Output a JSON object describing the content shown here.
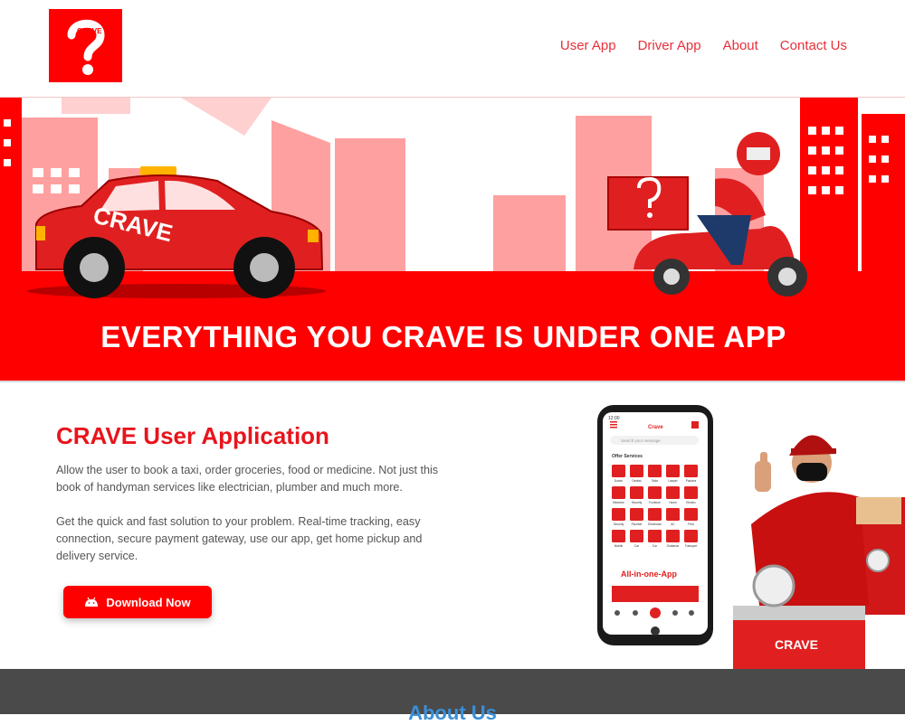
{
  "header": {
    "logo_text": "CRAVE",
    "nav": [
      "User App",
      "Driver App",
      "About",
      "Contact Us"
    ]
  },
  "hero": {
    "headline": "EVERYTHING YOU CRAVE IS UNDER ONE APP",
    "car_text": "CRAVE"
  },
  "user_app": {
    "title": "CRAVE User Application",
    "paragraph1": "Allow the user to book a taxi, order groceries, food or medicine. Not just this book of handyman services like electrician, plumber and much more.",
    "paragraph2": "Get the quick and fast solution to your problem. Real-time tracking, easy connection, secure payment gateway, use our app, get home pickup and delivery service.",
    "download_label": "Download Now"
  },
  "phone": {
    "time": "12:00",
    "app_title": "Crave",
    "search_placeholder": "Search your message",
    "services_heading": "Offer Services",
    "banner_text": "All-in-one-App",
    "services": [
      "Doctor",
      "Dentist",
      "Tailor",
      "Lawyer",
      "Packers",
      "Medicine",
      "Security",
      "Furniture",
      "Home",
      "Electric",
      "Security",
      "Plumber",
      "Electrician",
      "AC",
      "Pest",
      "Mobile",
      "Car",
      "Car",
      "Guidance",
      "Transport"
    ]
  },
  "bag_text": "CRAVE",
  "footer": {
    "title": "About Us"
  },
  "colors": {
    "brand_red": "#ff0000",
    "accent_red": "#e8141c",
    "footer_bg": "#4a4a4a",
    "footer_title": "#3a8fd8"
  }
}
